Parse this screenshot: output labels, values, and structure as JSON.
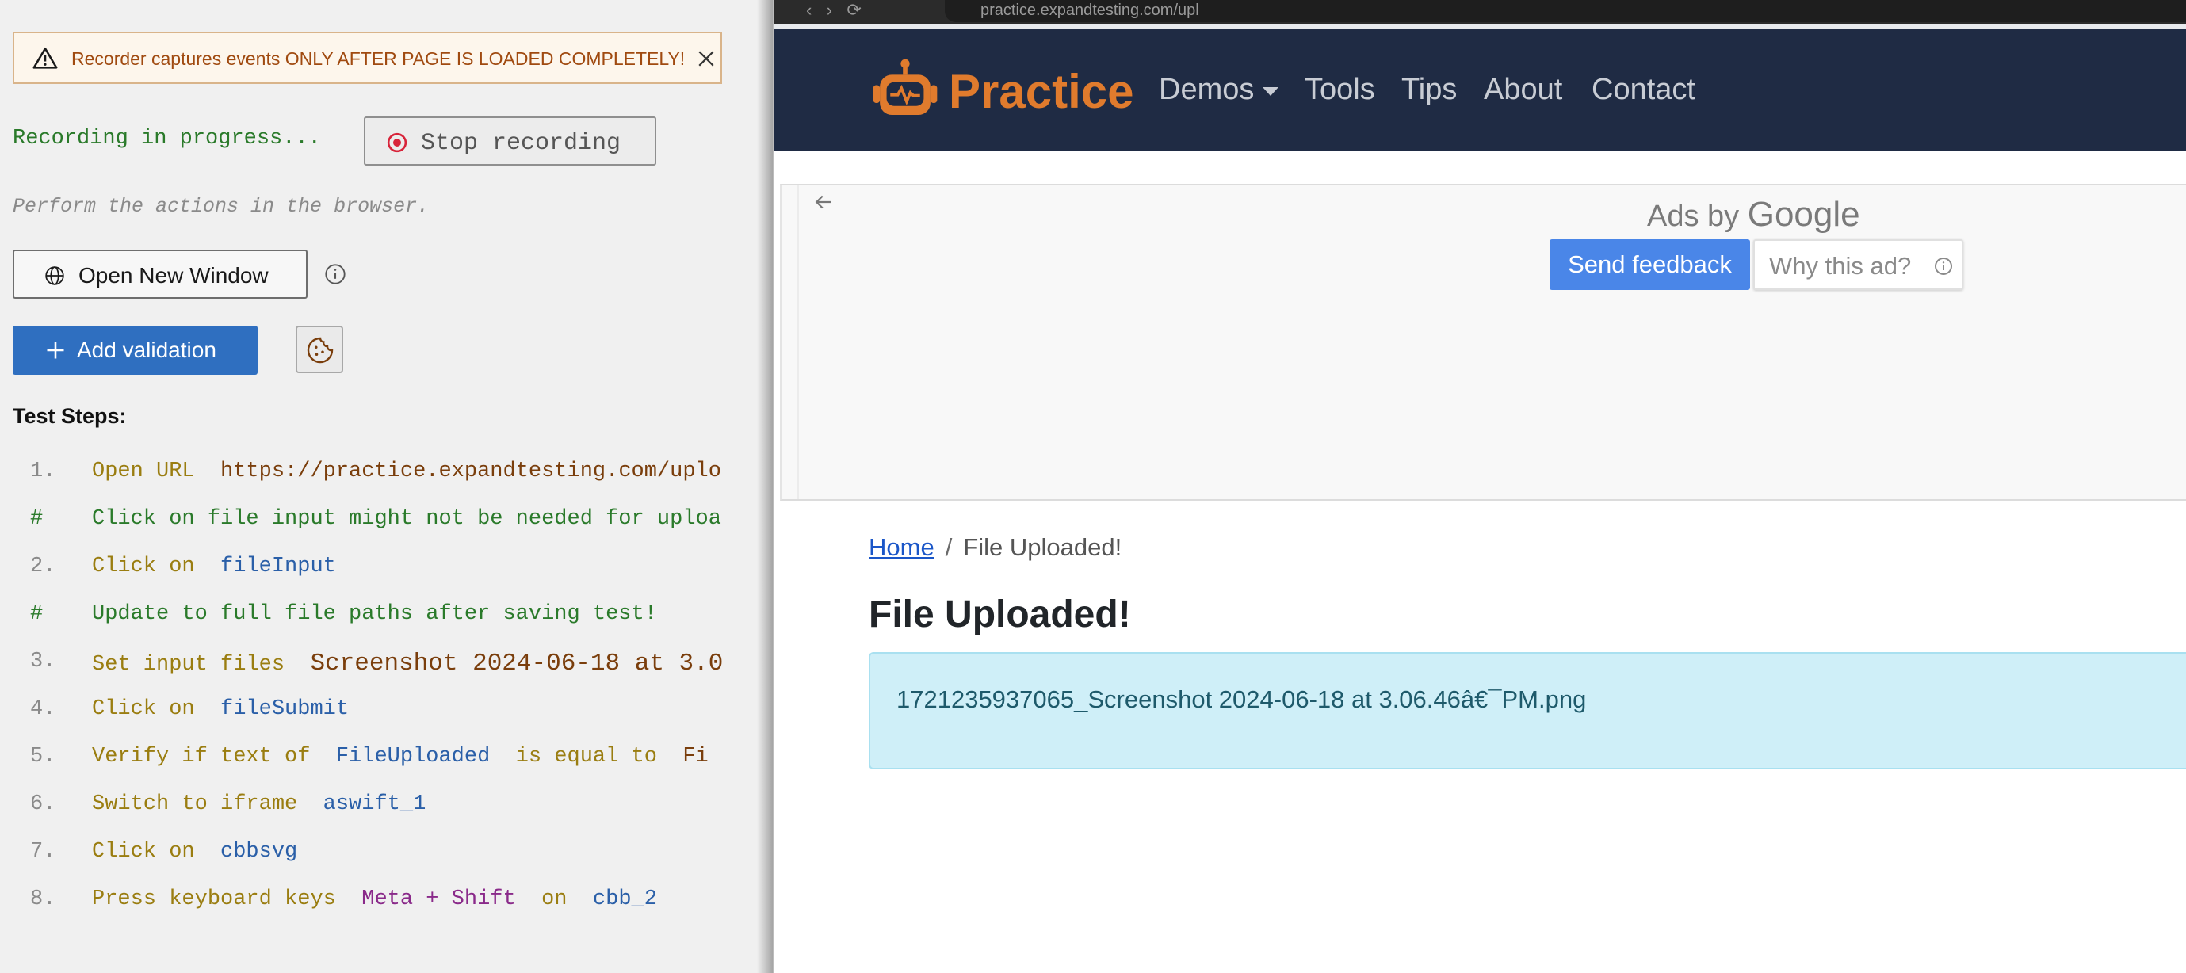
{
  "recorder": {
    "warning": {
      "text": "Recorder captures events ONLY AFTER PAGE IS LOADED COMPLETELY!",
      "icon": "warning-triangle-icon",
      "close_icon": "close-icon"
    },
    "status": "Recording in progress...",
    "stop_button": "Stop recording",
    "instruction": "Perform the actions in the browser.",
    "open_window_button": "Open New Window",
    "add_validation_button": "Add validation",
    "steps_title": "Test Steps:",
    "steps": [
      {
        "marker": "1.",
        "parts": [
          {
            "t": "Open URL",
            "c": "act"
          },
          {
            "t": "https://practice.expandtesting.com/uplo",
            "c": "url"
          }
        ]
      },
      {
        "marker": "#",
        "parts": [
          {
            "t": "Click on file input might not be needed for uploa",
            "c": "cmt"
          }
        ]
      },
      {
        "marker": "2.",
        "parts": [
          {
            "t": "Click on",
            "c": "act"
          },
          {
            "t": "fileInput",
            "c": "el"
          }
        ]
      },
      {
        "marker": "#",
        "parts": [
          {
            "t": "Update to full file paths after saving test!",
            "c": "cmt"
          }
        ]
      },
      {
        "marker": "3.",
        "parts": [
          {
            "t": "Set input files",
            "c": "act"
          },
          {
            "t": "Screenshot 2024-06-18 at 3.0",
            "c": "file"
          }
        ]
      },
      {
        "marker": "4.",
        "parts": [
          {
            "t": "Click on",
            "c": "act"
          },
          {
            "t": "fileSubmit",
            "c": "el"
          }
        ]
      },
      {
        "marker": "5.",
        "parts": [
          {
            "t": "Verify if text of",
            "c": "act"
          },
          {
            "t": "FileUploaded",
            "c": "el"
          },
          {
            "t": "is equal to",
            "c": "act"
          },
          {
            "t": "Fi",
            "c": "url"
          }
        ]
      },
      {
        "marker": "6.",
        "parts": [
          {
            "t": "Switch to iframe",
            "c": "act"
          },
          {
            "t": "aswift_1",
            "c": "el"
          }
        ]
      },
      {
        "marker": "7.",
        "parts": [
          {
            "t": "Click on",
            "c": "act"
          },
          {
            "t": "cbbsvg",
            "c": "el"
          }
        ]
      },
      {
        "marker": "8.",
        "parts": [
          {
            "t": "Press keyboard keys",
            "c": "act"
          },
          {
            "t": "Meta + Shift",
            "c": "kw"
          },
          {
            "t": "on",
            "c": "act"
          },
          {
            "t": "cbb_2",
            "c": "el"
          }
        ]
      }
    ]
  },
  "browser": {
    "url_partial": "practice.expandtesting.com/upl",
    "brand": "Practice",
    "nav": {
      "demos": "Demos",
      "tools": "Tools",
      "tips": "Tips",
      "about": "About",
      "contact": "Contact"
    },
    "ad": {
      "ads_by": "Ads by",
      "google": "Google",
      "send_feedback": "Send feedback",
      "why_this_ad": "Why this ad?"
    },
    "breadcrumb": {
      "home": "Home",
      "separator": "/",
      "current": "File Uploaded!"
    },
    "heading": "File Uploaded!",
    "uploaded_file": "1721235937065_Screenshot 2024-06-18 at 3.06.46â€¯PM.png"
  },
  "colors": {
    "navbar": "#1f2b44",
    "brand_orange": "#e07b2d",
    "primary_button": "#2f6fc0",
    "alert_bg": "#cfeff8"
  }
}
